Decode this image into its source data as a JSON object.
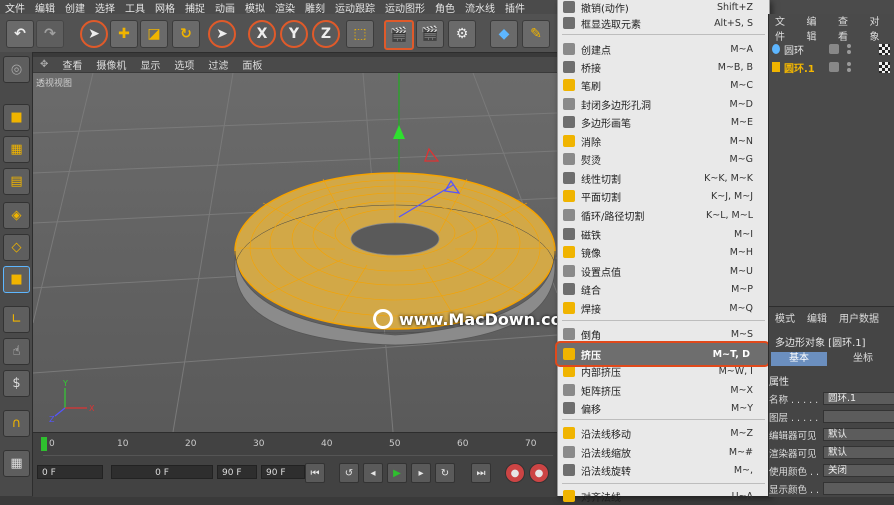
{
  "menubar": [
    "文件",
    "编辑",
    "创建",
    "选择",
    "工具",
    "网格",
    "捕捉",
    "动画",
    "模拟",
    "渲染",
    "雕刻",
    "运动跟踪",
    "运动图形",
    "角色",
    "流水线",
    "插件"
  ],
  "viewport": {
    "menu": [
      "查看",
      "摄像机",
      "显示",
      "选项",
      "过滤",
      "面板"
    ],
    "label": "透视视图",
    "watermark": "www.MacDown.com"
  },
  "timeline": {
    "ticks": [
      "0",
      "10",
      "20",
      "30",
      "40",
      "50",
      "60",
      "70"
    ],
    "start_field": "0 F",
    "current_field": "0 F",
    "end_field": "90 F",
    "end2_field": "90 F"
  },
  "menu": {
    "items": [
      {
        "label": "撤销(动作)",
        "shortcut": "Shift+Z"
      },
      {
        "label": "框显选取元素",
        "shortcut": "Alt+S, S"
      },
      {
        "label": "创建点",
        "shortcut": "M~A"
      },
      {
        "label": "桥接",
        "shortcut": "M~B, B"
      },
      {
        "label": "笔刷",
        "shortcut": "M~C"
      },
      {
        "label": "封闭多边形孔洞",
        "shortcut": "M~D"
      },
      {
        "label": "多边形画笔",
        "shortcut": "M~E"
      },
      {
        "label": "消除",
        "shortcut": "M~N"
      },
      {
        "label": "熨烫",
        "shortcut": "M~G"
      },
      {
        "label": "线性切割",
        "shortcut": "K~K, M~K"
      },
      {
        "label": "平面切割",
        "shortcut": "K~J, M~J"
      },
      {
        "label": "循环/路径切割",
        "shortcut": "K~L, M~L"
      },
      {
        "label": "磁铁",
        "shortcut": "M~I"
      },
      {
        "label": "镜像",
        "shortcut": "M~H"
      },
      {
        "label": "设置点值",
        "shortcut": "M~U"
      },
      {
        "label": "缝合",
        "shortcut": "M~P"
      },
      {
        "label": "焊接",
        "shortcut": "M~Q"
      },
      {
        "label": "倒角",
        "shortcut": "M~S"
      },
      {
        "label": "挤压",
        "shortcut": "M~T, D"
      },
      {
        "label": "内部挤压",
        "shortcut": "M~W, I"
      },
      {
        "label": "矩阵挤压",
        "shortcut": "M~X"
      },
      {
        "label": "偏移",
        "shortcut": "M~Y"
      },
      {
        "label": "沿法线移动",
        "shortcut": "M~Z"
      },
      {
        "label": "沿法线缩放",
        "shortcut": "M~#"
      },
      {
        "label": "沿法线旋转",
        "shortcut": "M~,"
      },
      {
        "label": "对齐法线",
        "shortcut": "U~A"
      }
    ]
  },
  "objects": {
    "menu": [
      "文件",
      "编辑",
      "查看",
      "对象"
    ],
    "items": [
      "圆环",
      "圆环.1"
    ]
  },
  "attributes": {
    "menu": [
      "模式",
      "编辑",
      "用户数据"
    ],
    "title": "多边形对象 [圆环.1]",
    "tab_basic": "基本",
    "tab_coord": "坐标",
    "section": "属性",
    "rows": [
      {
        "label": "名称 . . . . .",
        "value": "圆环.1"
      },
      {
        "label": "图层 . . . . .",
        "value": ""
      },
      {
        "label": "编辑器可见",
        "value": "默认"
      },
      {
        "label": "渲染器可见",
        "value": "默认"
      },
      {
        "label": "使用颜色 . .",
        "value": "关闭"
      },
      {
        "label": "显示颜色 . .",
        "value": ""
      }
    ]
  },
  "colors": {
    "accent": "#e0491b",
    "torus": "#e8b040",
    "wire": "#f6a300"
  }
}
